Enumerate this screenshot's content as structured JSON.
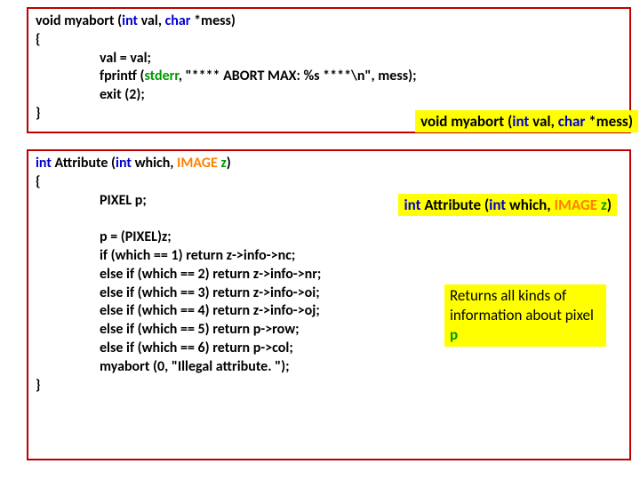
{
  "box1": {
    "sig_pre": "void myabort (",
    "sig_int": "int",
    "sig_mid": " val, ",
    "sig_char": "char",
    "sig_post": " *mess)",
    "open": "{",
    "l1": "val = val;",
    "l2a": "fprintf (",
    "l2_stderr": "stderr",
    "l2b": ", \"**** ABORT MAX: %s ****\\n\", mess);",
    "l3": "exit (2);",
    "close": "}"
  },
  "label1": {
    "pre": "void myabort (",
    "int": "int",
    "mid": " val, ",
    "char": "char",
    "post": " *mess)"
  },
  "box2": {
    "sig_int1": "int",
    "sig_a": " Attribute (",
    "sig_int2": "int",
    "sig_b": " which, ",
    "sig_img": "IMAGE",
    "sig_c": " ",
    "sig_z": "z",
    "sig_d": ")",
    "open": "{",
    "pixel": "PIXEL p;",
    "l1": "p = (PIXEL)z;",
    "l2": "if (which == 1) return z->info->nc;",
    "l3": "else if (which == 2) return z->info->nr;",
    "l4": "else if (which == 3) return z->info->oi;",
    "l5": "else if (which == 4) return z->info->oj;",
    "l6": "else if (which == 5) return p->row;",
    "l7": "else if (which == 6) return p->col;",
    "l8": "myabort (0, \"Illegal attribute. \");",
    "close": "}"
  },
  "label2": {
    "int1": "int",
    "a": " Attribute (",
    "int2": "int",
    "b": " which, ",
    "img": "IMAGE",
    "c": " ",
    "z": "z",
    "d": ")"
  },
  "label3": {
    "text_a": "Returns all kinds of information about pixel ",
    "p": "p"
  }
}
